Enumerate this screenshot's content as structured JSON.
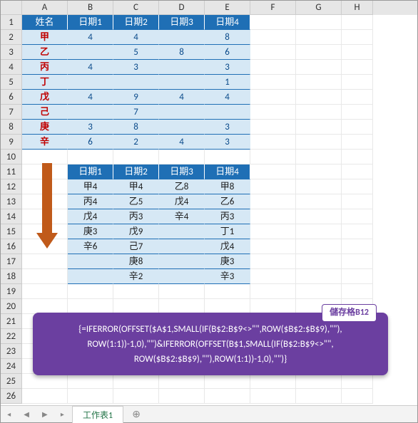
{
  "columns": [
    "A",
    "B",
    "C",
    "D",
    "E",
    "F",
    "G",
    "H"
  ],
  "rowCount": 26,
  "t1": {
    "headers": [
      "姓名",
      "日期1",
      "日期2",
      "日期3",
      "日期4"
    ],
    "rows": [
      {
        "n": "甲",
        "v": [
          "4",
          "4",
          "",
          "8"
        ]
      },
      {
        "n": "乙",
        "v": [
          "",
          "5",
          "8",
          "6"
        ]
      },
      {
        "n": "丙",
        "v": [
          "4",
          "3",
          "",
          "3"
        ]
      },
      {
        "n": "丁",
        "v": [
          "",
          "",
          "",
          "1"
        ]
      },
      {
        "n": "戊",
        "v": [
          "4",
          "9",
          "4",
          "4"
        ]
      },
      {
        "n": "己",
        "v": [
          "",
          "7",
          "",
          ""
        ]
      },
      {
        "n": "庚",
        "v": [
          "3",
          "8",
          "",
          "3"
        ]
      },
      {
        "n": "辛",
        "v": [
          "6",
          "2",
          "4",
          "3"
        ]
      }
    ]
  },
  "t2": {
    "headers": [
      "日期1",
      "日期2",
      "日期3",
      "日期4"
    ],
    "rows": [
      [
        "甲4",
        "甲4",
        "乙8",
        "甲8"
      ],
      [
        "丙4",
        "乙5",
        "戊4",
        "乙6"
      ],
      [
        "戊4",
        "丙3",
        "辛4",
        "丙3"
      ],
      [
        "庚3",
        "戊9",
        "",
        "丁1"
      ],
      [
        "辛6",
        "己7",
        "",
        "戊4"
      ],
      [
        "",
        "庚8",
        "",
        "庚3"
      ],
      [
        "",
        "辛2",
        "",
        "辛3"
      ]
    ]
  },
  "callout": {
    "label": "儲存格B12",
    "line1": "{=IFERROR(OFFSET($A$1,SMALL(IF(B$2:B$9<>\"\",ROW($B$2:$B$9),\"\"),",
    "line2": "ROW(1:1))-1,0),\"\")&IFERROR(OFFSET(B$1,SMALL(IF(B$2:B$9<>\"\",",
    "line3": "ROW($B$2:$B$9),\"\"),ROW(1:1))-1,0),\"\")}"
  },
  "tab": "工作表1",
  "nav": [
    "◂",
    "◀",
    "▶",
    "▸"
  ],
  "add": "⊕"
}
